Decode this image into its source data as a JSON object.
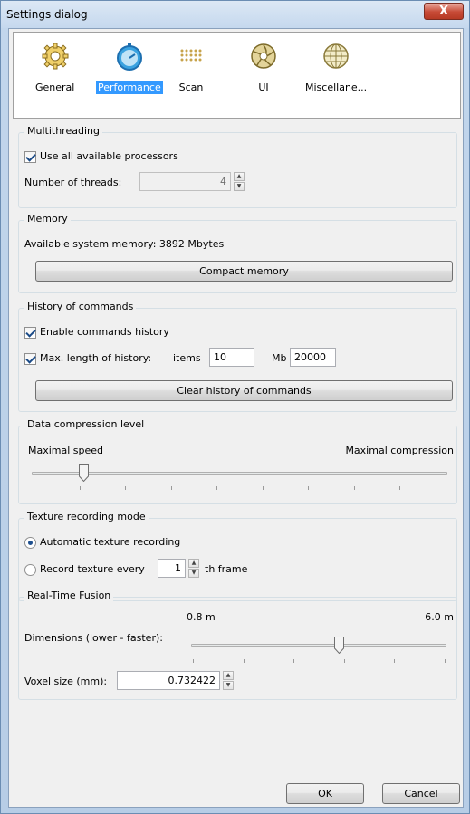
{
  "window": {
    "title": "Settings dialog",
    "close_glyph": "X"
  },
  "toolbar": {
    "items": [
      {
        "label": "General",
        "icon": "gear-icon"
      },
      {
        "label": "Performance",
        "icon": "stopwatch-icon",
        "selected": true
      },
      {
        "label": "Scan",
        "icon": "dot-grid-icon"
      },
      {
        "label": "UI",
        "icon": "aperture-icon"
      },
      {
        "label": "Miscellane...",
        "icon": "globe-icon"
      }
    ]
  },
  "multithreading": {
    "title": "Multithreading",
    "use_all_label": "Use all available processors",
    "use_all_checked": true,
    "threads_label": "Number of threads:",
    "threads_value": "4"
  },
  "memory": {
    "title": "Memory",
    "available_text": "Available system memory: 3892 Mbytes",
    "compact_button": "Compact memory"
  },
  "history": {
    "title": "History of commands",
    "enable_label": "Enable commands history",
    "enable_checked": true,
    "maxlen_label": "Max. length of history:",
    "maxlen_checked": true,
    "items_label": "items",
    "items_value": "10",
    "mb_label": "Mb",
    "mb_value": "20000",
    "clear_button": "Clear history of commands"
  },
  "compression": {
    "title": "Data compression level",
    "left_label": "Maximal speed",
    "right_label": "Maximal compression",
    "level_fraction": 0.12
  },
  "texture": {
    "title": "Texture recording mode",
    "auto_label": "Automatic texture recording",
    "auto_selected": true,
    "every_label": "Record texture every",
    "every_value": "1",
    "every_suffix": "th frame"
  },
  "fusion": {
    "title": "Real-Time Fusion",
    "min_label": "0.8 m",
    "max_label": "6.0 m",
    "dimensions_label": "Dimensions (lower - faster):",
    "dimensions_fraction": 0.58,
    "voxel_label": "Voxel size (mm):",
    "voxel_value": "0.732422"
  },
  "footer": {
    "ok_button": "OK",
    "cancel_button": "Cancel"
  }
}
